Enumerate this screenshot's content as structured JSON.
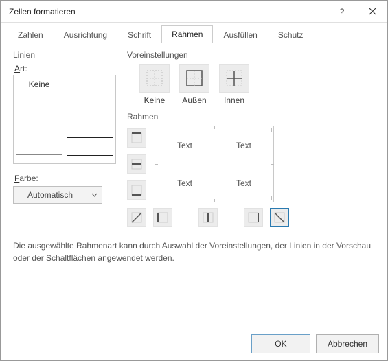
{
  "window": {
    "title": "Zellen formatieren"
  },
  "tabs": {
    "items": [
      "Zahlen",
      "Ausrichtung",
      "Schrift",
      "Rahmen",
      "Ausfüllen",
      "Schutz"
    ],
    "active_index": 3
  },
  "linien": {
    "group": "Linien",
    "art_label": "Art:",
    "none_label": "Keine",
    "farbe_label": "Farbe:",
    "farbe_value": "Automatisch"
  },
  "voreinstellungen": {
    "group": "Voreinstellungen",
    "presets": [
      {
        "id": "none",
        "label": "Keine"
      },
      {
        "id": "outer",
        "label": "Außen"
      },
      {
        "id": "inner",
        "label": "Innen"
      }
    ]
  },
  "rahmen": {
    "group": "Rahmen",
    "preview_text": "Text"
  },
  "helptext": "Die ausgewählte Rahmenart kann durch Auswahl der Voreinstellungen, der Linien in der Vorschau oder der Schaltflächen angewendet werden.",
  "footer": {
    "ok": "OK",
    "cancel": "Abbrechen"
  }
}
